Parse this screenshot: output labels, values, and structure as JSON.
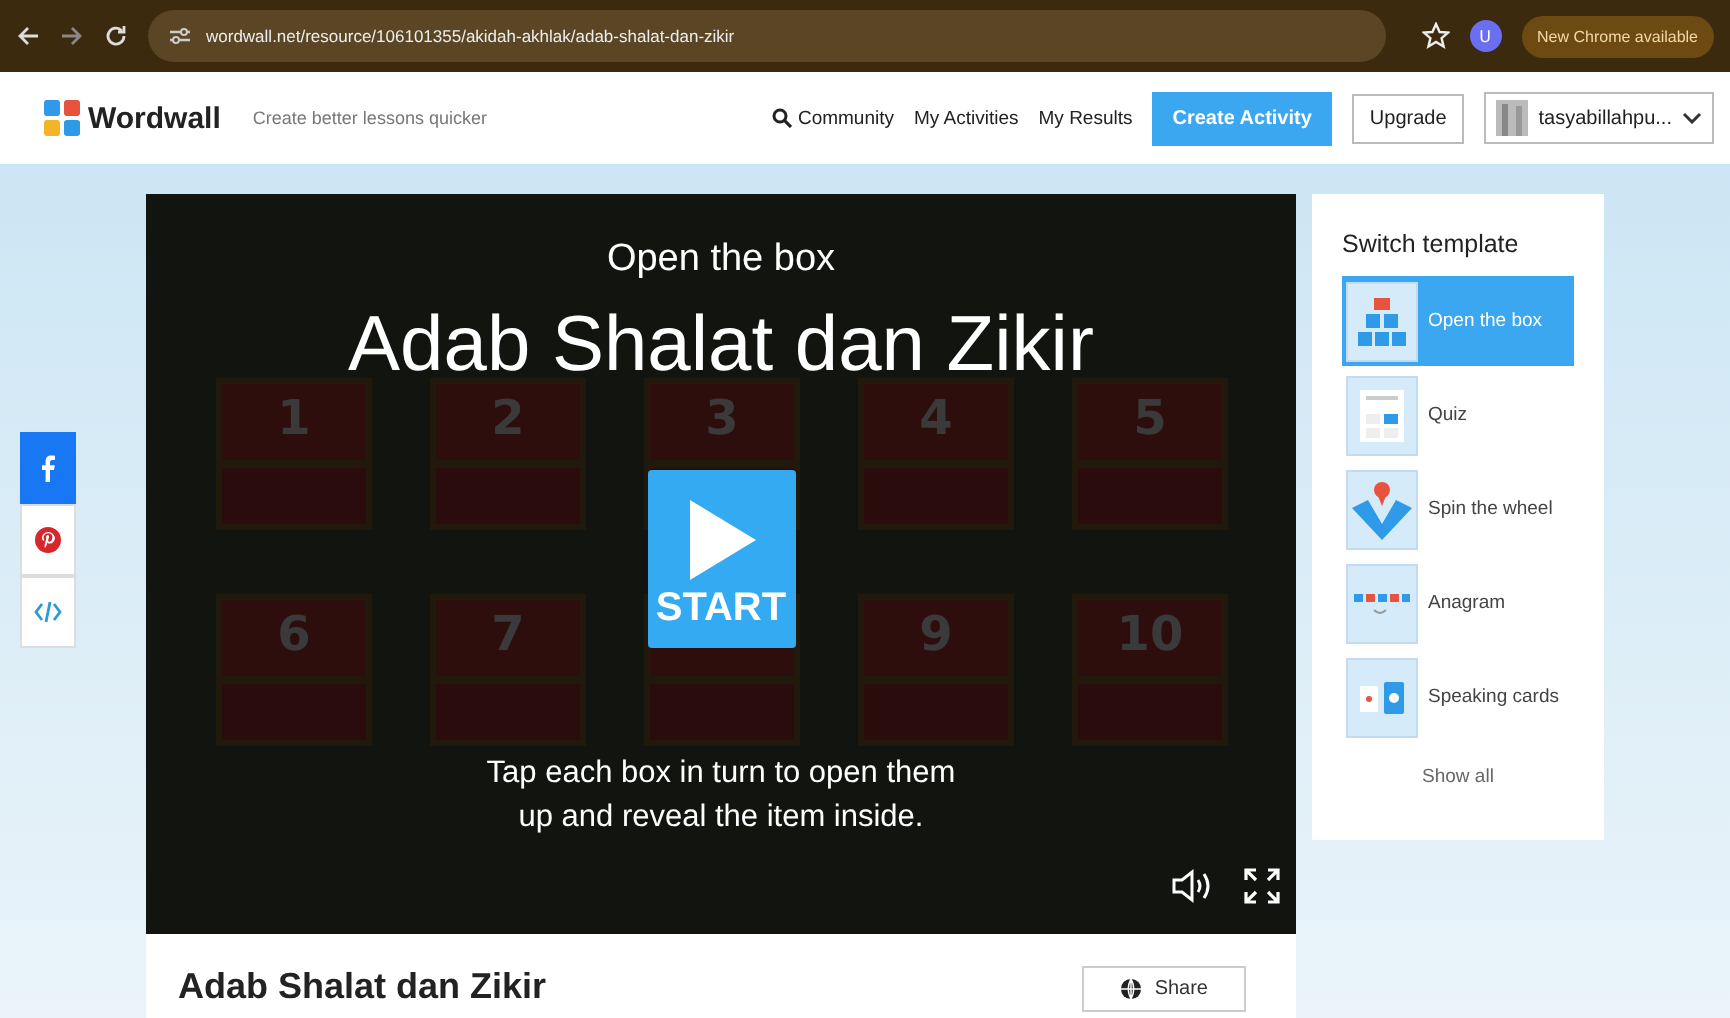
{
  "browser": {
    "url": "wordwall.net/resource/106101355/akidah-akhlak/adab-shalat-dan-zikir",
    "profile_initial": "U",
    "update_label": "New Chrome available"
  },
  "header": {
    "logo": "Wordwall",
    "tagline": "Create better lessons quicker",
    "nav": [
      {
        "label": "Community",
        "kind": "search"
      },
      {
        "label": "My Activities",
        "kind": "link"
      },
      {
        "label": "My Results",
        "kind": "link"
      }
    ],
    "create_button": "Create Activity",
    "upgrade_button": "Upgrade",
    "user": "tasyabillahpu..."
  },
  "game": {
    "template": "Open the box",
    "title": "Adab Shalat dan Zikir",
    "start": "START",
    "instructions": "Tap each box in turn to open them up and reveal the item inside.",
    "boxes": [
      {
        "kind": "chest",
        "number": "1"
      },
      {
        "kind": "chest",
        "number": "2"
      },
      {
        "kind": "chest",
        "number": "3"
      },
      {
        "kind": "chest",
        "number": "4"
      },
      {
        "kind": "chest",
        "number": "5"
      },
      {
        "kind": "chest",
        "number": "6"
      },
      {
        "kind": "chest",
        "number": "7"
      },
      {
        "kind": "chest"
      },
      {
        "kind": "chest",
        "number": "9"
      },
      {
        "kind": "chest",
        "number": "10"
      }
    ]
  },
  "activity": {
    "title": "Adab Shalat dan Zikir",
    "share": "Share"
  },
  "templates": {
    "title": "Switch template",
    "items": [
      {
        "label": "Open the box",
        "kind": "box",
        "selected": true
      },
      {
        "label": "Quiz",
        "kind": "quiz",
        "selected": false
      },
      {
        "label": "Spin the wheel",
        "kind": "wheel",
        "selected": false
      },
      {
        "label": "Anagram",
        "kind": "anagram",
        "selected": false
      },
      {
        "label": "Speaking cards",
        "kind": "cards",
        "selected": false
      }
    ],
    "show_all": "Show all"
  },
  "social": [
    {
      "kind": "facebook"
    },
    {
      "kind": "pinterest"
    },
    {
      "kind": "embed"
    }
  ]
}
